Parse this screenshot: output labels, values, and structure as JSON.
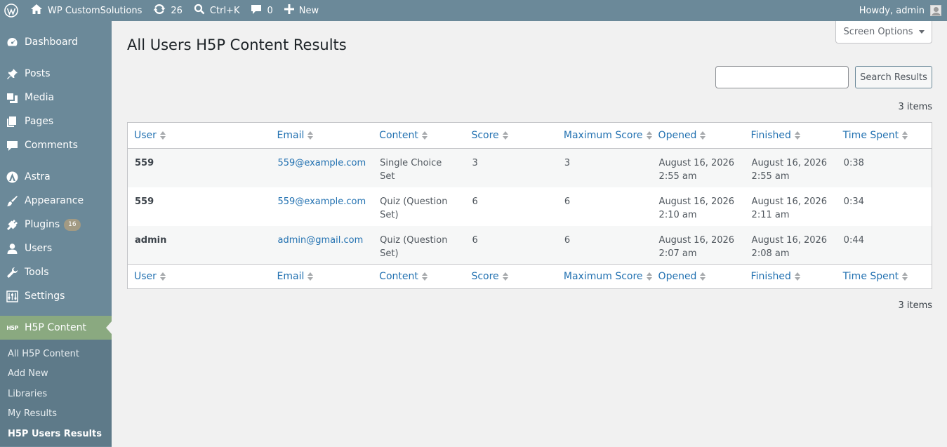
{
  "adminbar": {
    "site_name": "WP CustomSolutions",
    "updates_count": "26",
    "search_shortcut": "Ctrl+K",
    "comments_count": "0",
    "new_label": "New",
    "howdy": "Howdy, admin"
  },
  "sidebar": {
    "items": [
      {
        "label": "Dashboard",
        "icon": "dashboard-icon"
      },
      {
        "label": "Posts",
        "icon": "pin-icon"
      },
      {
        "label": "Media",
        "icon": "media-icon"
      },
      {
        "label": "Pages",
        "icon": "pages-icon"
      },
      {
        "label": "Comments",
        "icon": "comment-icon"
      },
      {
        "label": "Astra",
        "icon": "astra-icon"
      },
      {
        "label": "Appearance",
        "icon": "brush-icon"
      },
      {
        "label": "Plugins",
        "icon": "plug-icon",
        "badge": "16"
      },
      {
        "label": "Users",
        "icon": "user-icon"
      },
      {
        "label": "Tools",
        "icon": "wrench-icon"
      },
      {
        "label": "Settings",
        "icon": "settings-icon"
      }
    ],
    "current": {
      "label": "H5P Content",
      "icon_text": "H5P"
    },
    "submenu": [
      "All H5P Content",
      "Add New",
      "Libraries",
      "My Results",
      "H5P Users Results"
    ]
  },
  "main": {
    "screen_options": "Screen Options",
    "title": "All Users H5P Content Results",
    "search_placeholder": "",
    "search_button": "Search Results",
    "items_count": "3 items",
    "columns": [
      "User",
      "Email",
      "Content",
      "Score",
      "Maximum Score",
      "Opened",
      "Finished",
      "Time Spent"
    ],
    "rows": [
      {
        "user": "559",
        "email": "559@example.com",
        "content": "Single Choice Set",
        "score": "3",
        "max_score": "3",
        "opened_date": "August 16, 2026",
        "opened_time": "2:55 am",
        "finished_date": "August 16, 2026",
        "finished_time": "2:55 am",
        "time_spent": "0:38"
      },
      {
        "user": "559",
        "email": "559@example.com",
        "content": "Quiz (Question Set)",
        "score": "6",
        "max_score": "6",
        "opened_date": "August 16, 2026",
        "opened_time": "2:10 am",
        "finished_date": "August 16, 2026",
        "finished_time": "2:11 am",
        "time_spent": "0:34"
      },
      {
        "user": "admin",
        "email": "admin@gmail.com",
        "content": "Quiz (Question Set)",
        "score": "6",
        "max_score": "6",
        "opened_date": "August 16, 2026",
        "opened_time": "2:07 am",
        "finished_date": "August 16, 2026",
        "finished_time": "2:08 am",
        "time_spent": "0:44"
      }
    ]
  },
  "colors": {
    "adminbar_bg": "#6b8999",
    "sidebar_current_bg": "#8aa980",
    "link": "#2271b1",
    "badge_bg": "#a29a83"
  }
}
